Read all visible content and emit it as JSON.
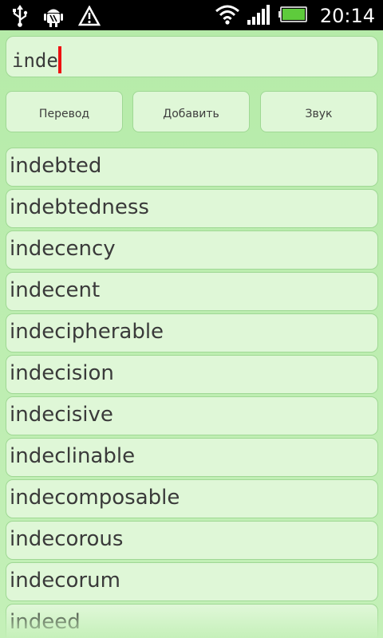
{
  "status_bar": {
    "time": "20:14",
    "icons": [
      "usb-icon",
      "android-debug-icon",
      "warning-icon",
      "wifi-icon",
      "signal-icon",
      "battery-icon"
    ]
  },
  "search": {
    "value": "inde"
  },
  "buttons": {
    "translate": "Перевод",
    "add": "Добавить",
    "sound": "Звук"
  },
  "words": [
    "indebted",
    "indebtedness",
    "indecency",
    "indecent",
    "indecipherable",
    "indecision",
    "indecisive",
    "indeclinable",
    "indecomposable",
    "indecorous",
    "indecorum",
    "indeed"
  ],
  "colors": {
    "background": "#b9ecad",
    "field": "#dff7d7",
    "border": "#9fd894",
    "caret": "#ee1111",
    "status_bar": "#000000",
    "battery": "#5ecb3c"
  }
}
